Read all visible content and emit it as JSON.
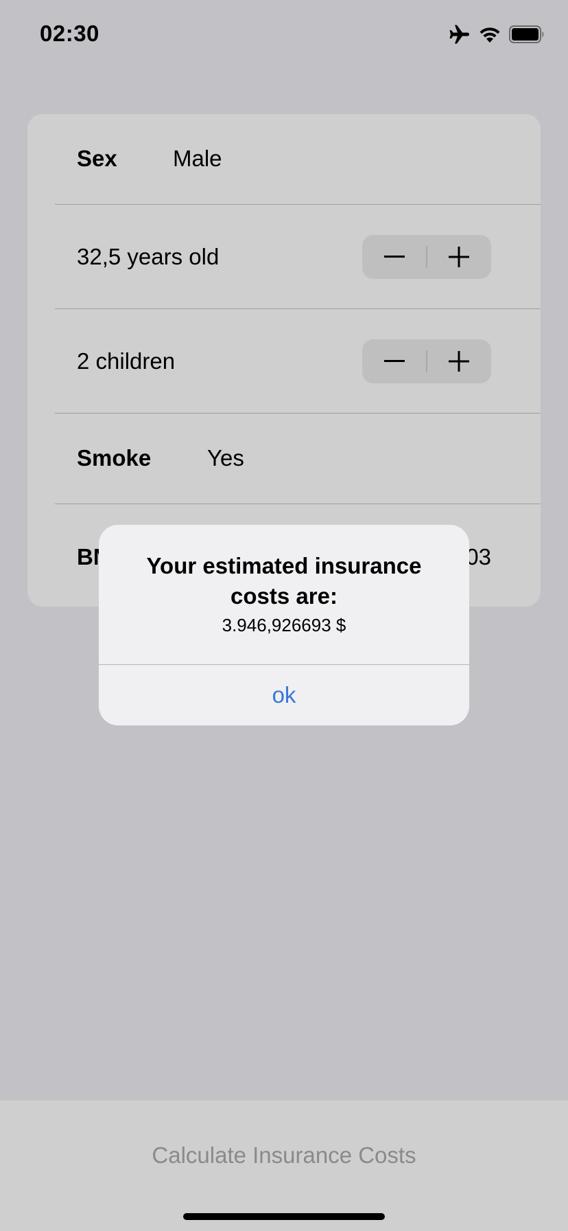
{
  "status_bar": {
    "time": "02:30",
    "icons": [
      "airplane-icon",
      "wifi-icon",
      "battery-icon"
    ]
  },
  "form": {
    "sex": {
      "label": "Sex",
      "value": "Male"
    },
    "age": {
      "text": "32,5 years old"
    },
    "children": {
      "text": "2 children"
    },
    "smoke": {
      "label": "Smoke",
      "value": "Yes"
    },
    "bmi": {
      "label_visible": "BN",
      "value_visible": "03"
    }
  },
  "alert": {
    "title": "Your estimated insurance costs are:",
    "message": "3.946,926693 $",
    "ok_label": "ok"
  },
  "footer": {
    "calculate_label": "Calculate Insurance Costs"
  },
  "colors": {
    "background": "#c2c1c6",
    "card": "#cfcfcf",
    "alert_bg": "#f0f0f2",
    "accent": "#3a77d6",
    "disabled_text": "#8a8a8a"
  }
}
